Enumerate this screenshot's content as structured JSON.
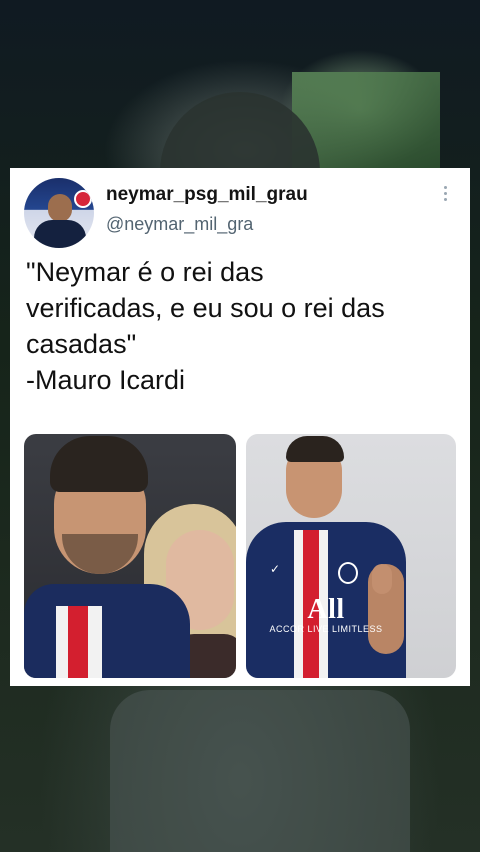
{
  "tweet": {
    "display_name": "neymar_psg_mil_grau",
    "handle": "@neymar_mil_gra",
    "text_lines": [
      "\"Neymar é o rei das",
      "verificadas, e eu sou o rei das",
      "casadas\"",
      "-Mauro Icardi"
    ]
  },
  "images": [
    {
      "name": "couple-photo"
    },
    {
      "name": "player-photo",
      "sponsor_logo": "All",
      "sponsor_text": "ACCOR LIVE LIMITLESS"
    }
  ],
  "icons": {
    "more": "more-vertical-icon"
  }
}
